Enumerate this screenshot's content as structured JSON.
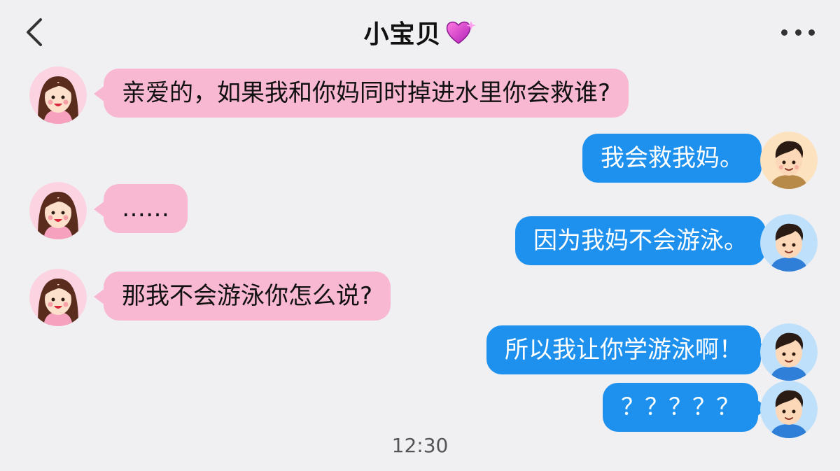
{
  "header": {
    "back_icon": "chevron-left-icon",
    "title": "小宝贝",
    "title_emoji_icon": "sparkling-heart-icon",
    "more_icon": "more-horizontal-icon"
  },
  "colors": {
    "background": "#f0f0f2",
    "left_bubble": "#f9b8d2",
    "right_bubble": "#1e90ee",
    "right_text": "#ffffff",
    "heart": "#e040c8"
  },
  "messages": [
    {
      "side": "left",
      "sender_avatar": "girl-avatar-icon",
      "text": "亲爱的，如果我和你妈同时掉进水里你会救谁?"
    },
    {
      "side": "right",
      "sender_avatar": "boy-avatar-icon",
      "text": "我会救我妈。"
    },
    {
      "side": "left",
      "sender_avatar": "girl-avatar-icon",
      "text": "……"
    },
    {
      "side": "right",
      "sender_avatar": "boy-avatar-icon",
      "text": "因为我妈不会游泳。"
    },
    {
      "side": "left",
      "sender_avatar": "girl-avatar-icon",
      "text": "那我不会游泳你怎么说?"
    },
    {
      "side": "right",
      "sender_avatar": "boy-avatar-icon",
      "text": "所以我让你学游泳啊！"
    },
    {
      "side": "right",
      "sender_avatar": "boy-avatar-icon",
      "text": "？？？？？"
    }
  ],
  "timestamp": "12:30"
}
